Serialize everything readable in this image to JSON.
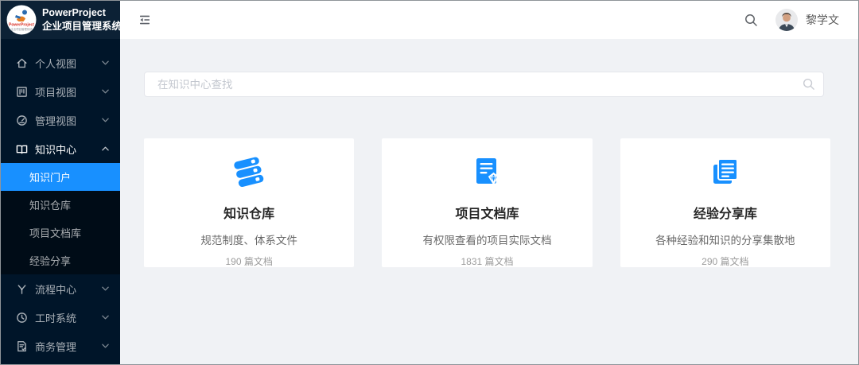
{
  "app": {
    "name": "PowerProject",
    "subtitle": "企业项目管理系统"
  },
  "header": {
    "user_name": "黎学文"
  },
  "sidebar": {
    "items": [
      {
        "label": "个人视图",
        "icon": "home-icon",
        "expandable": true
      },
      {
        "label": "项目视图",
        "icon": "project-icon",
        "expandable": true
      },
      {
        "label": "管理视图",
        "icon": "dashboard-icon",
        "expandable": true
      },
      {
        "label": "知识中心",
        "icon": "read-icon",
        "expandable": true,
        "expanded": true,
        "children": [
          {
            "label": "知识门户",
            "active": true
          },
          {
            "label": "知识仓库"
          },
          {
            "label": "项目文档库"
          },
          {
            "label": "经验分享"
          }
        ]
      },
      {
        "label": "流程中心",
        "icon": "branch-icon",
        "expandable": true
      },
      {
        "label": "工时系统",
        "icon": "clock-icon",
        "expandable": true
      },
      {
        "label": "商务管理",
        "icon": "audit-icon",
        "expandable": true
      }
    ]
  },
  "main": {
    "search_placeholder": "在知识中心查找",
    "cards": [
      {
        "title": "知识仓库",
        "desc": "规范制度、体系文件",
        "count": "190 篇文档",
        "icon": "books-icon"
      },
      {
        "title": "项目文档库",
        "desc": "有权限查看的项目实际文档",
        "count": "1831 篇文档",
        "icon": "doc-gem-icon"
      },
      {
        "title": "经验分享库",
        "desc": "各种经验和知识的分享集散地",
        "count": "290 篇文档",
        "icon": "newspaper-icon"
      }
    ]
  },
  "colors": {
    "accent": "#1890ff",
    "sidebar_bg": "#001529",
    "submenu_bg": "#000c17",
    "content_bg": "#f0f2f5"
  }
}
